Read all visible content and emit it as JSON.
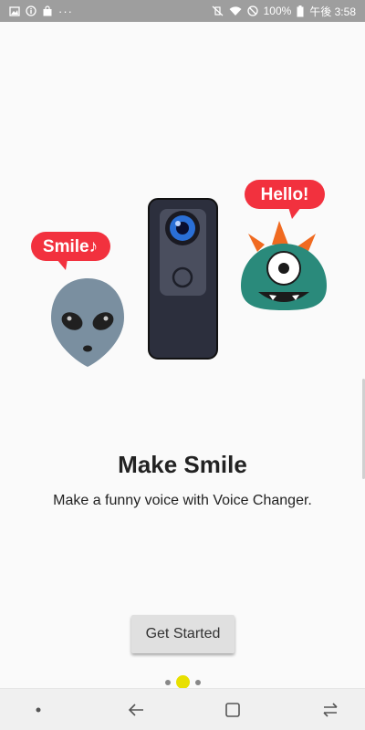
{
  "status_bar": {
    "battery": "100%",
    "time": "午後 3:58",
    "overflow": "···",
    "icons_left": [
      "photo-notification-icon",
      "info-icon",
      "shopping-bag-icon"
    ],
    "icons_right": [
      "vibrate-mute-icon",
      "wifi-icon",
      "do-not-disturb-icon",
      "battery-icon"
    ]
  },
  "illustration": {
    "left_bubble": "Smile♪",
    "right_bubble": "Hello!",
    "characters": [
      "alien",
      "camera",
      "one-eyed-monster"
    ],
    "colors": {
      "bubble": "#f2313e",
      "alien": "#7a8fa0",
      "monster": "#2a8a7b",
      "monster_horns": "#f06a20",
      "camera_body": "#2c2f3d",
      "camera_lens": "#2a6fd6"
    }
  },
  "main": {
    "title": "Make Smile",
    "subtitle": "Make a funny voice with Voice Changer.",
    "cta_label": "Get Started"
  },
  "pager": {
    "count": 3,
    "active_index": 1,
    "active_color": "#e8e000"
  },
  "nav_bar": {
    "items": [
      "dot-icon",
      "back-icon",
      "home-icon",
      "recents-icon"
    ]
  }
}
